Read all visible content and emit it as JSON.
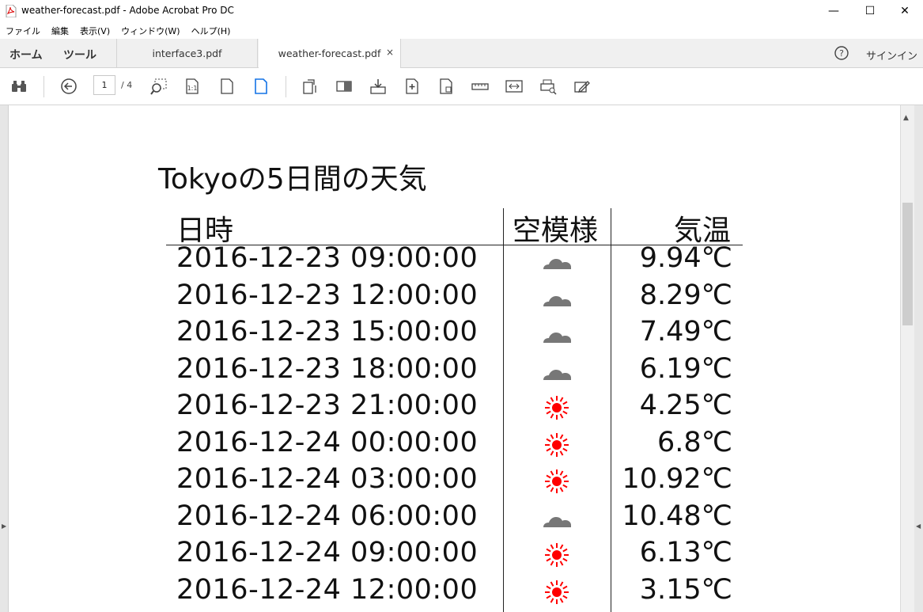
{
  "window": {
    "title": "weather-forecast.pdf - Adobe Acrobat Pro DC",
    "minimize": "—",
    "maximize": "☐",
    "close": "✕"
  },
  "menu": [
    "ファイル",
    "編集",
    "表示(V)",
    "ウィンドウ(W)",
    "ヘルプ(H)"
  ],
  "tabs": {
    "home": "ホーム",
    "tools": "ツール",
    "docs": [
      {
        "label": "interface3.pdf",
        "active": false
      },
      {
        "label": "weather-forecast.pdf",
        "active": true,
        "close": "×"
      }
    ]
  },
  "account": {
    "signin": "サインイン",
    "help_icon": "help-circle-icon"
  },
  "toolbar": {
    "page_current": "1",
    "page_total": "/ 4"
  },
  "scroll": {
    "up_arrow": "▲",
    "left_arrow": "▶",
    "right_arrow": "◀"
  },
  "document": {
    "title": "Tokyoの5日間の天気",
    "columns": {
      "date": "日時",
      "sky": "空模様",
      "temp": "気温"
    },
    "rows": [
      {
        "date": "2016-12-23 09:00:00",
        "sky": "cloud-icon",
        "temp": "9.94℃"
      },
      {
        "date": "2016-12-23 12:00:00",
        "sky": "cloud-icon",
        "temp": "8.29℃"
      },
      {
        "date": "2016-12-23 15:00:00",
        "sky": "cloud-icon",
        "temp": "7.49℃"
      },
      {
        "date": "2016-12-23 18:00:00",
        "sky": "cloud-icon",
        "temp": "6.19℃"
      },
      {
        "date": "2016-12-23 21:00:00",
        "sky": "sun-icon",
        "temp": "4.25℃"
      },
      {
        "date": "2016-12-24 00:00:00",
        "sky": "sun-icon",
        "temp": "6.8℃"
      },
      {
        "date": "2016-12-24 03:00:00",
        "sky": "sun-icon",
        "temp": "10.92℃"
      },
      {
        "date": "2016-12-24 06:00:00",
        "sky": "cloud-icon",
        "temp": "10.48℃"
      },
      {
        "date": "2016-12-24 09:00:00",
        "sky": "sun-icon",
        "temp": "6.13℃"
      },
      {
        "date": "2016-12-24 12:00:00",
        "sky": "sun-icon",
        "temp": "3.15℃"
      }
    ]
  },
  "colors": {
    "sun": "#ff0000",
    "cloud": "#777777",
    "accent": "#1473e6"
  }
}
